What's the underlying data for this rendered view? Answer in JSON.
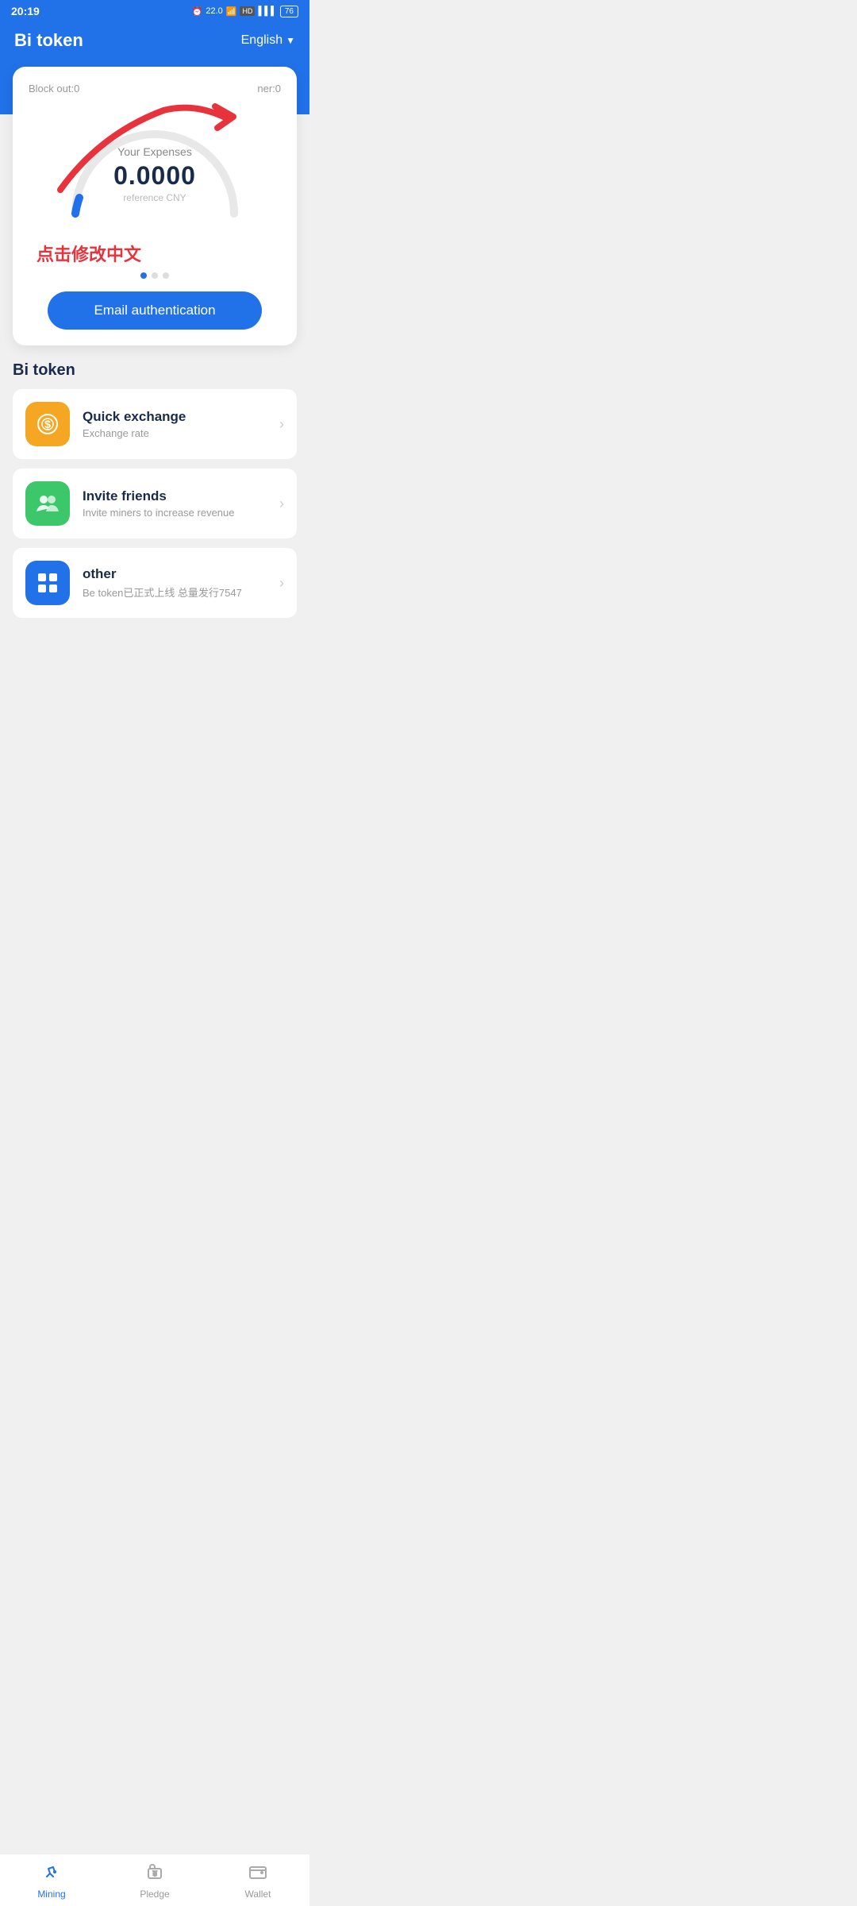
{
  "statusBar": {
    "time": "20:19",
    "icons": "⏰ 22.0 KB/S 📶 HD 4G 4G 76"
  },
  "header": {
    "title": "Bi token",
    "language": "English",
    "chevron": "▼"
  },
  "card": {
    "blockOut": "Block out:0",
    "minerLabel": "ner:0",
    "expensesLabel": "Your Expenses",
    "expensesValue": "0.0000",
    "expensesSub": "reference CNY",
    "chineseAnnotation": "点击修改中文",
    "emailAuthBtn": "Email authentication"
  },
  "section": {
    "title": "Bi token"
  },
  "listItems": [
    {
      "id": "quick-exchange",
      "iconType": "orange",
      "title": "Quick exchange",
      "subtitle": "Exchange rate"
    },
    {
      "id": "invite-friends",
      "iconType": "green",
      "title": "Invite friends",
      "subtitle": "Invite miners to increase revenue"
    },
    {
      "id": "other",
      "iconType": "blue",
      "title": "other",
      "subtitle": "Be token已正式上线 总量发行7547"
    }
  ],
  "bottomNav": [
    {
      "id": "mining",
      "label": "Mining",
      "active": true
    },
    {
      "id": "pledge",
      "label": "Pledge",
      "active": false
    },
    {
      "id": "wallet",
      "label": "Wallet",
      "active": false
    }
  ]
}
